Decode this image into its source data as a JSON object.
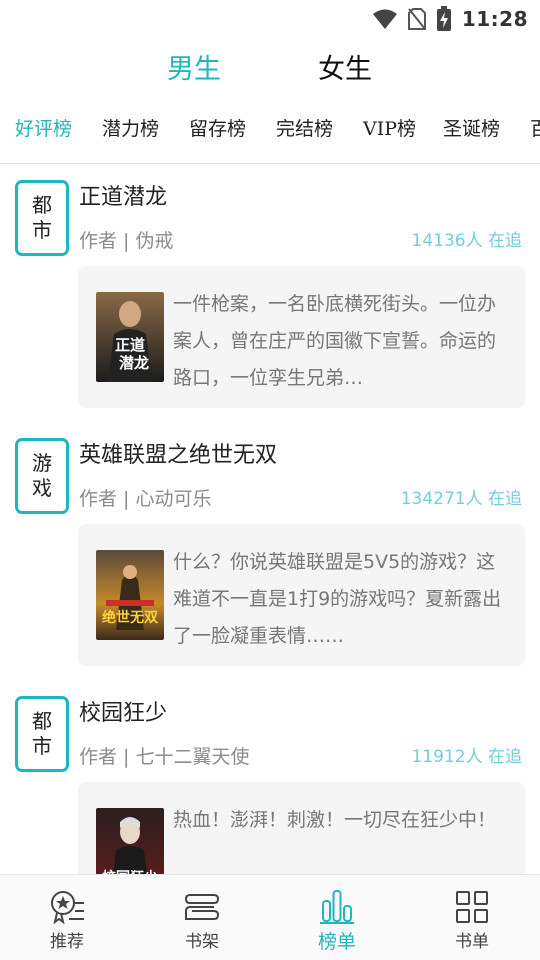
{
  "status_bar": {
    "time": "11:28",
    "icons": [
      "wifi-icon",
      "no-sim-icon",
      "battery-charging-icon"
    ]
  },
  "gender_tabs": [
    {
      "label": "男生",
      "active": true
    },
    {
      "label": "女生",
      "active": false
    }
  ],
  "rank_tabs": [
    {
      "label": "好评榜",
      "active": true
    },
    {
      "label": "潜力榜",
      "active": false
    },
    {
      "label": "留存榜",
      "active": false
    },
    {
      "label": "完结榜",
      "active": false
    },
    {
      "label": "VIP榜",
      "active": false
    },
    {
      "label": "圣诞榜",
      "active": false
    },
    {
      "label": "百",
      "active": false
    }
  ],
  "books": [
    {
      "genre_line1": "都",
      "genre_line2": "市",
      "title": "正道潜龙",
      "author_label": "作者 | 伪戒",
      "followers": "14136人 在追",
      "summary": "一件枪案，一名卧底横死街头。一位办案人，曾在庄严的国徽下宣誓。命运的路口，一位孪生兄弟…",
      "cover_text": "正道潜龙",
      "cover_colors": [
        "#2a2a2a",
        "#8a6a48"
      ]
    },
    {
      "genre_line1": "游",
      "genre_line2": "戏",
      "title": "英雄联盟之绝世无双",
      "author_label": "作者 | 心动可乐",
      "followers": "134271人 在追",
      "summary": "什么？你说英雄联盟是5V5的游戏？这难道不一直是1打9的游戏吗？夏新露出了一脸凝重表情……",
      "cover_text": "绝世无双",
      "cover_colors": [
        "#4a3a2a",
        "#c88a2a"
      ]
    },
    {
      "genre_line1": "都",
      "genre_line2": "市",
      "title": "校园狂少",
      "author_label": "作者 | 七十二翼天使",
      "followers": "11912人 在追",
      "summary": "热血！澎湃！刺激！一切尽在狂少中！",
      "cover_text": "校园狂少",
      "cover_colors": [
        "#1a1a1a",
        "#8a2a2a"
      ]
    }
  ],
  "bottom_nav": [
    {
      "label": "推荐",
      "icon": "recommend-icon",
      "active": false
    },
    {
      "label": "书架",
      "icon": "bookshelf-icon",
      "active": false
    },
    {
      "label": "榜单",
      "icon": "ranking-icon",
      "active": true
    },
    {
      "label": "书单",
      "icon": "booklist-grid-icon",
      "active": false
    }
  ],
  "colors": {
    "accent": "#1eb6c0",
    "follow_text": "#74cfd6",
    "card_bg": "#f5f5f5"
  }
}
